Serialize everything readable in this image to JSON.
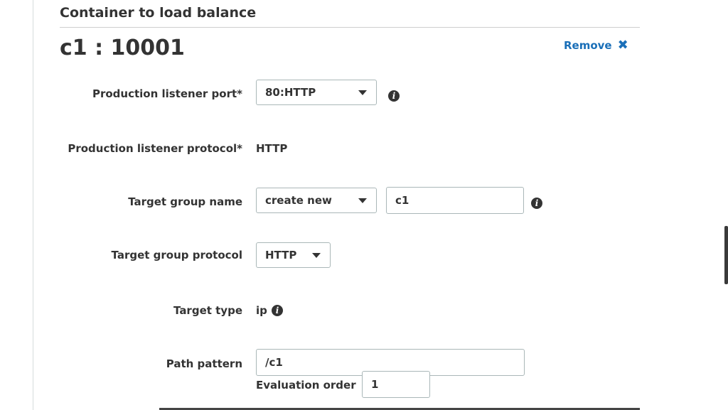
{
  "section": {
    "title": "Container to load balance"
  },
  "container": {
    "title": "c1 : 10001",
    "remove_label": "Remove",
    "remove_icon": "close-icon"
  },
  "form": {
    "prod_port": {
      "label": "Production listener port*",
      "value": "80:HTTP"
    },
    "prod_protocol": {
      "label": "Production listener protocol*",
      "value": "HTTP"
    },
    "tg_name": {
      "label": "Target group name",
      "select_value": "create new",
      "input_value": "c1"
    },
    "tg_protocol": {
      "label": "Target group protocol",
      "value": "HTTP"
    },
    "target_type": {
      "label": "Target type",
      "value": "ip"
    },
    "path_pattern": {
      "label": "Path pattern",
      "value": "/c1"
    },
    "eval_order": {
      "label": "Evaluation order",
      "value": "1"
    }
  },
  "icons": {
    "info": "i"
  },
  "colors": {
    "link": "#1a6fb8",
    "text": "#333333",
    "border": "#aab7b8"
  }
}
